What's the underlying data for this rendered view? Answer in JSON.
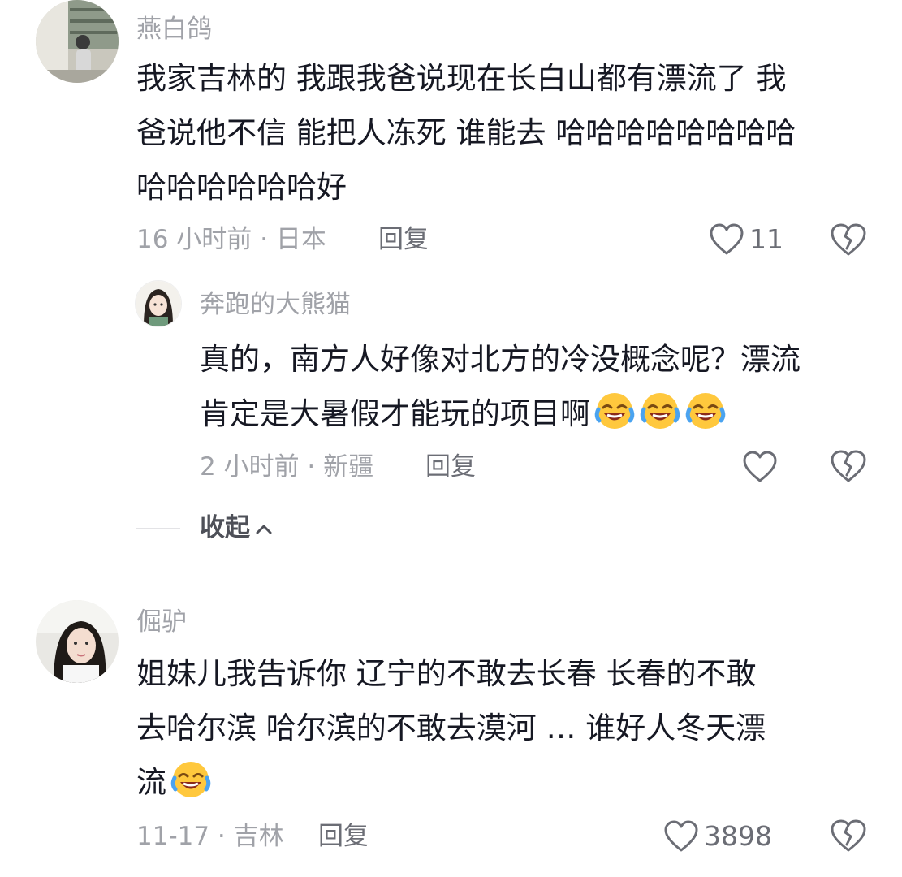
{
  "comments": [
    {
      "username": "燕白鸽",
      "lines": [
        "我家吉林的  我跟我爸说现在长白山都有漂流了 我",
        "爸说他不信 能把人冻死 谁能去 哈哈哈哈哈哈哈哈",
        "哈哈哈哈哈哈好"
      ],
      "meta": "16 小时前 · 日本",
      "reply_label": "回复",
      "like_count": "11"
    },
    {
      "username": "奔跑的大熊猫",
      "lines": [
        "真的，南方人好像对北方的冷没概念呢？漂流",
        "肯定是大暑假才能玩的项目啊"
      ],
      "emoji": [
        "laugh-cry-emoji",
        "laugh-cry-emoji",
        "laugh-cry-emoji"
      ],
      "meta": "2 小时前 · 新疆",
      "reply_label": "回复",
      "like_count": ""
    },
    {
      "username": "倔驴",
      "lines": [
        "姐妹儿我告诉你  辽宁的不敢去长春   长春的不敢",
        "去哈尔滨  哈尔滨的不敢去漠河  … 谁好人冬天漂",
        "流"
      ],
      "emoji": [
        "laugh-cry-emoji"
      ],
      "meta": "11-17 · 吉林",
      "reply_label": "回复",
      "like_count": "3898"
    }
  ],
  "collapse_label": "收起",
  "icons": {
    "like": "heart-outline-icon",
    "dislike": "broken-heart-icon",
    "collapse": "chevron-up-icon"
  },
  "colors": {
    "text": "#161823",
    "secondary": "#a0a2a8",
    "action": "#6b6d75",
    "emoji_face": "#ffc83d"
  }
}
